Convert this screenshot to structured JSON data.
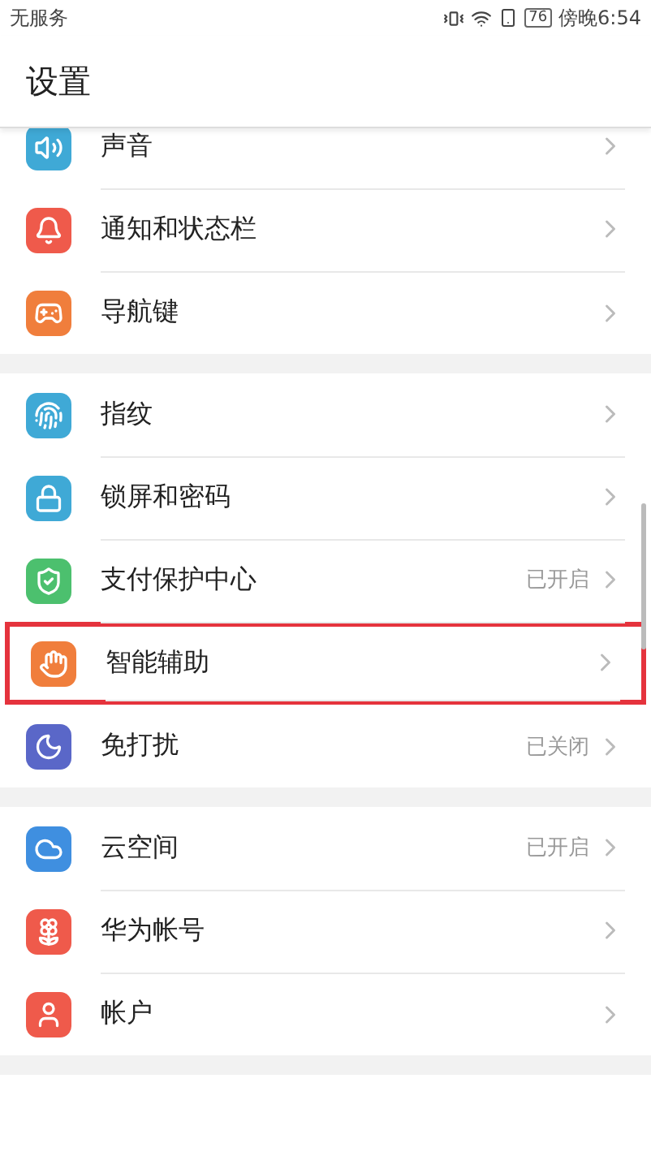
{
  "status_bar": {
    "carrier": "无服务",
    "battery": "76",
    "time": "傍晚6:54"
  },
  "header": {
    "title": "设置"
  },
  "sections": [
    {
      "items": [
        {
          "label": "声音",
          "color": "#3fa9d6",
          "highlighted": false
        },
        {
          "label": "通知和状态栏",
          "color": "#ef5a4b",
          "highlighted": false
        },
        {
          "label": "导航键",
          "color": "#f07e3c",
          "highlighted": false
        }
      ]
    },
    {
      "items": [
        {
          "label": "指纹",
          "color": "#3fa9d6",
          "highlighted": false
        },
        {
          "label": "锁屏和密码",
          "color": "#3fa9d6",
          "highlighted": false
        },
        {
          "label": "支付保护中心",
          "value": "已开启",
          "color": "#4cc06e",
          "highlighted": false
        },
        {
          "label": "智能辅助",
          "color": "#f07e3c",
          "highlighted": true
        },
        {
          "label": "免打扰",
          "value": "已关闭",
          "color": "#5a67c8",
          "highlighted": false
        }
      ]
    },
    {
      "items": [
        {
          "label": "云空间",
          "value": "已开启",
          "color": "#3f8fe0",
          "highlighted": false
        },
        {
          "label": "华为帐号",
          "color": "#ef5a4b",
          "highlighted": false
        },
        {
          "label": "帐户",
          "color": "#ef5a4b",
          "highlighted": false
        }
      ]
    }
  ]
}
